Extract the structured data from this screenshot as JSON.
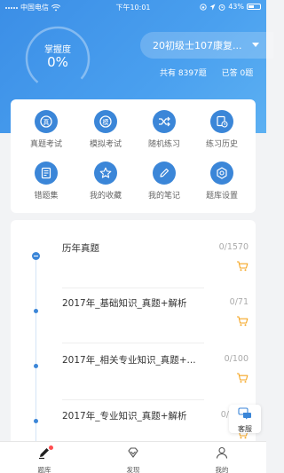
{
  "status_bar": {
    "carrier": "中国电信",
    "time": "下午10:01",
    "battery": "43%"
  },
  "header": {
    "mastery_label": "掌握度",
    "mastery_value": "0%",
    "mastery_fraction": 0,
    "bank_name": "20初级士107康复...",
    "total_label": "共有 8397题",
    "answered_label": "已答 0题"
  },
  "menu": {
    "items": [
      {
        "label": "真题考试",
        "icon": "exam-icon"
      },
      {
        "label": "模拟考试",
        "icon": "mock-exam-icon"
      },
      {
        "label": "随机练习",
        "icon": "shuffle-icon"
      },
      {
        "label": "练习历史",
        "icon": "history-icon"
      },
      {
        "label": "错题集",
        "icon": "wrong-book-icon"
      },
      {
        "label": "我的收藏",
        "icon": "star-icon"
      },
      {
        "label": "我的笔记",
        "icon": "pencil-icon"
      },
      {
        "label": "题库设置",
        "icon": "settings-icon"
      }
    ]
  },
  "list": {
    "rows": [
      {
        "title": "历年真题",
        "count": "0/1570"
      },
      {
        "title": "2017年_基础知识_真题+解析",
        "count": "0/71"
      },
      {
        "title": "2017年_相关专业知识_真题+...",
        "count": "0/100"
      },
      {
        "title": "2017年_专业知识_真题+解析",
        "count": "0/1"
      }
    ]
  },
  "support": {
    "label": "客服"
  },
  "tabbar": {
    "items": [
      {
        "label": "题库"
      },
      {
        "label": "发现"
      },
      {
        "label": "我的"
      }
    ]
  },
  "colors": {
    "primary": "#3b86d8",
    "header_start": "#3b8ee6",
    "cart": "#f5a623"
  }
}
